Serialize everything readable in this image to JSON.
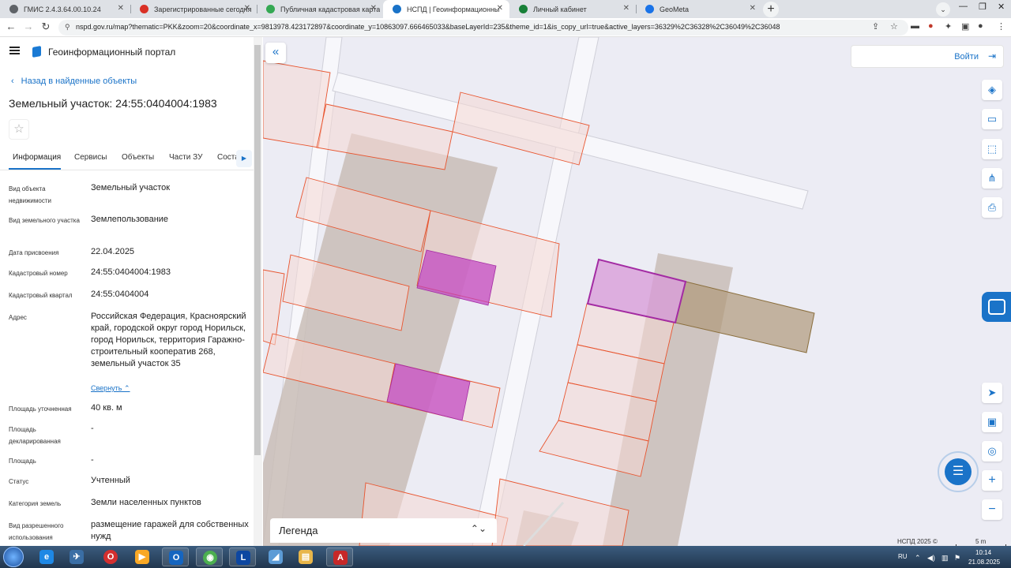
{
  "browser": {
    "tabs": [
      {
        "title": "ГМИС 2.4.3.64.00.10.24",
        "favicon_color": "#5f6368"
      },
      {
        "title": "Зарегистрированные сегодня",
        "favicon_color": "#d93025"
      },
      {
        "title": "Публичная кадастровая карта",
        "favicon_color": "#34a853"
      },
      {
        "title": "НСПД | Геоинформационный п",
        "favicon_color": "#1a73c8"
      },
      {
        "title": "Личный кабинет",
        "favicon_color": "#188038"
      },
      {
        "title": "GeoMeta",
        "favicon_color": "#1a73e8"
      }
    ],
    "url": "nspd.gov.ru/map?thematic=PKK&zoom=20&coordinate_x=9813978.423172897&coordinate_y=10863097.666465033&baseLayerId=235&theme_id=1&is_copy_url=true&active_layers=36329%2C36328%2C36049%2C36048"
  },
  "portal": {
    "title": "Геоинформационный портал",
    "back_link": "Назад в найденные объекты",
    "object_title": "Земельный участок: 24:55:0404004:1983",
    "tabs": [
      "Информация",
      "Сервисы",
      "Объекты",
      "Части ЗУ",
      "Соста"
    ],
    "properties": [
      {
        "label": "Вид объекта недвижимости",
        "value": "Земельный участок"
      },
      {
        "label": "Вид земельного участка",
        "value": "Землепользование"
      },
      {
        "label": "Дата присвоения",
        "value": "22.04.2025"
      },
      {
        "label": "Кадастровый номер",
        "value": "24:55:0404004:1983"
      },
      {
        "label": "Кадастровый квартал",
        "value": "24:55:0404004"
      },
      {
        "label": "Адрес",
        "value": "Российская Федерация, Красноярский край, городской округ город Норильск, город Норильск, территория Гаражно-строительный кооператив 268, земельный участок 35"
      },
      {
        "label": "Площадь уточненная",
        "value": "40 кв. м"
      },
      {
        "label": "Площадь декларированная",
        "value": "-"
      },
      {
        "label": "Площадь",
        "value": "-"
      },
      {
        "label": "Статус",
        "value": "Учтенный"
      },
      {
        "label": "Категория земель",
        "value": "Земли населенных пунктов"
      },
      {
        "label": "Вид разрешенного использования",
        "value": "размещение гаражей для собственных нужд"
      }
    ],
    "collapse_link": "Свернуть"
  },
  "map": {
    "login_label": "Войти",
    "legend_label": "Легенда",
    "attribution": "НСПД 2025 ©",
    "scale_label": "5 m",
    "accent_color": "#1a73c8",
    "selected_parcel_color": "#a32ba3"
  },
  "taskbar": {
    "language": "RU",
    "time": "10:14",
    "date": "21.08.2025"
  }
}
